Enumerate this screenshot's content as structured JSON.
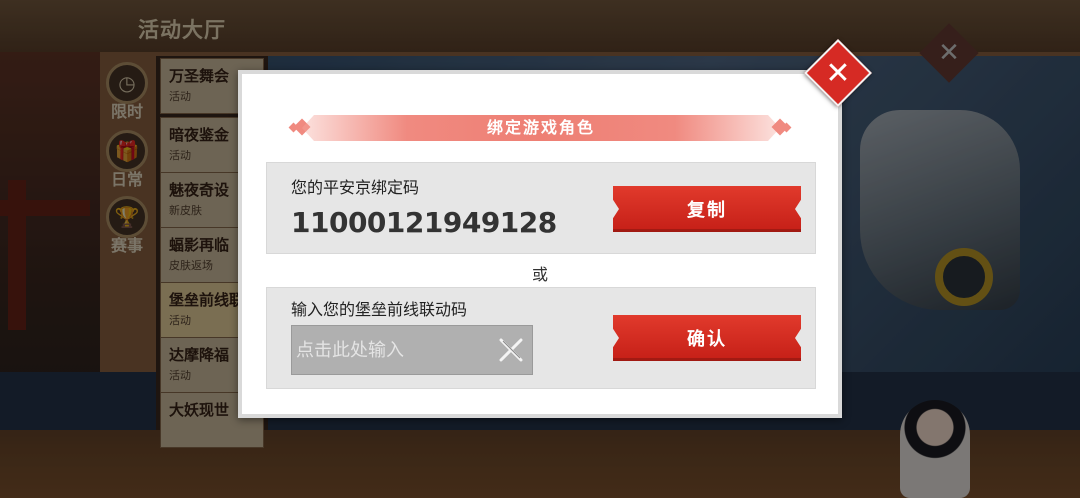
{
  "background": {
    "hall_title": "活动大厅",
    "side_tabs": [
      {
        "label": "限时",
        "icon": "clock-icon",
        "glyph": "◷"
      },
      {
        "label": "日常",
        "icon": "gift-icon",
        "glyph": "🎁"
      },
      {
        "label": "赛事",
        "icon": "trophy-icon",
        "glyph": "🏆"
      }
    ],
    "activities": [
      {
        "name": "万圣舞会",
        "sub": "活动"
      },
      {
        "name": "暗夜鉴金",
        "sub": "活动"
      },
      {
        "name": "魅夜奇设",
        "sub": "新皮肤"
      },
      {
        "name": "蝠影再临",
        "sub": "皮肤返场"
      },
      {
        "name": "堡垒前线联",
        "sub": "活动"
      },
      {
        "name": "达摩降福",
        "sub": "活动"
      },
      {
        "name": "大妖现世",
        "sub": ""
      }
    ],
    "close_glyph": "✕"
  },
  "dialog": {
    "title": "绑定游戏角色",
    "close_glyph": "✕",
    "bind_section": {
      "label": "您的平安京绑定码",
      "code": "11000121949128",
      "copy_button": "复制"
    },
    "or_text": "或",
    "link_section": {
      "label": "输入您的堡垒前线联动码",
      "input_value": "",
      "input_placeholder": "点击此处输入",
      "confirm_button": "确认"
    }
  },
  "colors": {
    "accent_red": "#d62a24",
    "ribbon_pink": "#f08a80",
    "panel_gray": "#e6e6e6"
  }
}
